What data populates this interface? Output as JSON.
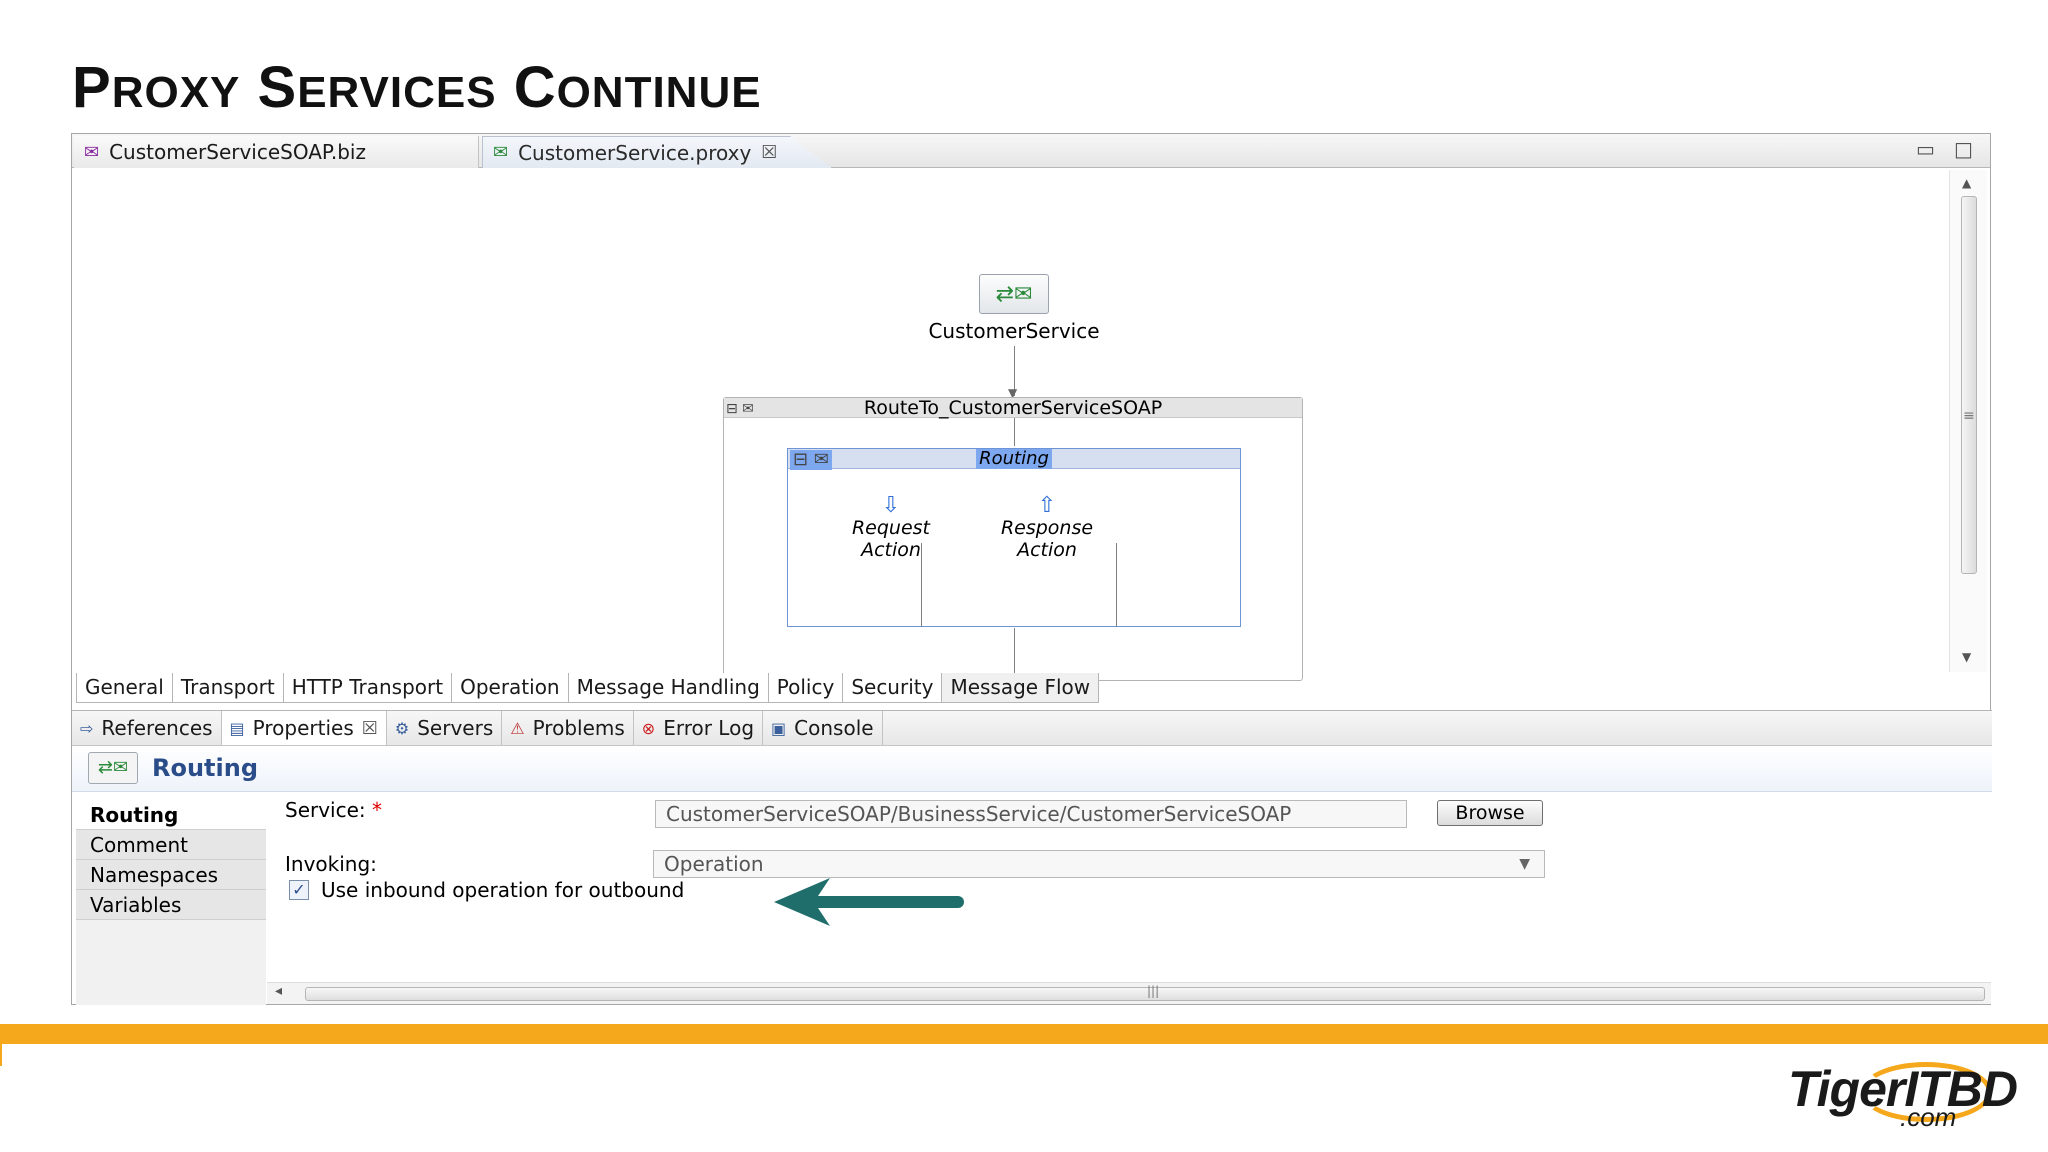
{
  "slide": {
    "title": "Proxy Services Continue"
  },
  "editor": {
    "tabs": [
      {
        "label": "CustomerServiceSOAP.biz",
        "icon": "business-service-icon",
        "active": false
      },
      {
        "label": "CustomerService.proxy",
        "icon": "proxy-service-icon",
        "active": true
      }
    ],
    "close_glyph": "☒"
  },
  "flow": {
    "start_node": {
      "label": "CustomerService",
      "icon": "proxy-envelope-icon"
    },
    "route_node": {
      "label": "RouteTo_CustomerServiceSOAP"
    },
    "routing": {
      "label": "Routing",
      "request_action": "Request Action",
      "response_action": "Response Action"
    }
  },
  "editor_bottom_tabs": [
    "General",
    "Transport",
    "HTTP Transport",
    "Operation",
    "Message Handling",
    "Policy",
    "Security",
    "Message Flow"
  ],
  "editor_bottom_active": "Message Flow",
  "views": {
    "tabs": [
      {
        "label": "References",
        "icon": "references-icon"
      },
      {
        "label": "Properties",
        "icon": "properties-icon",
        "active": true
      },
      {
        "label": "Servers",
        "icon": "servers-icon"
      },
      {
        "label": "Problems",
        "icon": "problems-icon"
      },
      {
        "label": "Error Log",
        "icon": "error-log-icon"
      },
      {
        "label": "Console",
        "icon": "console-icon"
      }
    ]
  },
  "properties": {
    "title": "Routing",
    "side_tabs": [
      "Routing",
      "Comment",
      "Namespaces",
      "Variables"
    ],
    "service_label": "Service:",
    "service_required": "*",
    "service_value": "CustomerServiceSOAP/BusinessService/CustomerServiceSOAP",
    "browse_label": "Browse",
    "invoking_label": "Invoking:",
    "invoking_value": "Operation",
    "checkbox_label": "Use inbound operation for outbound",
    "checkbox_checked": true
  },
  "colors": {
    "accent_bar": "#f5a81c",
    "annotation_arrow": "#1f6e6b",
    "selection": "#7da7ef"
  },
  "logo": {
    "text": "TigerITBD",
    "sub": ".com"
  }
}
